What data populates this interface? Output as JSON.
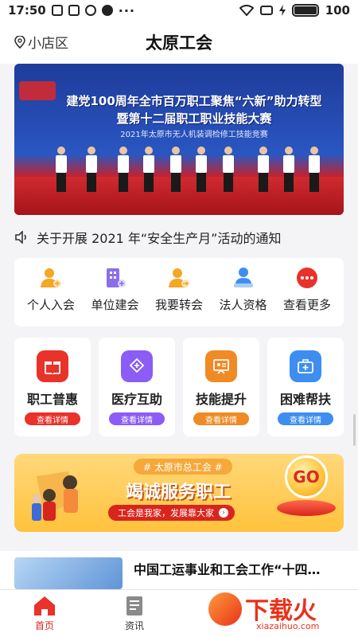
{
  "status_bar": {
    "time": "17:50",
    "battery": "100"
  },
  "header": {
    "location": "小店区",
    "title": "太原工会"
  },
  "banner": {
    "line1": "建党100周年全市百万职工聚焦“六新”助力转型",
    "line2": "暨第十二届职工职业技能大赛",
    "line3": "2021年太原市无人机装调检修工技能竞赛"
  },
  "notice": {
    "text": "关于开展 2021 年“安全生产月”活动的通知"
  },
  "quick_actions": [
    {
      "label": "个人入会",
      "icon": "person-join-icon",
      "color": "#f5a623"
    },
    {
      "label": "单位建会",
      "icon": "building-icon",
      "color": "#8b6fe8"
    },
    {
      "label": "我要转会",
      "icon": "person-transfer-icon",
      "color": "#f5a623"
    },
    {
      "label": "法人资格",
      "icon": "legal-person-icon",
      "color": "#3d8ef0"
    },
    {
      "label": "查看更多",
      "icon": "more-icon",
      "color": "#e8322a"
    }
  ],
  "services": [
    {
      "title": "职工普惠",
      "button": "查看详情",
      "icon": "gift-icon",
      "color": "#e8322a"
    },
    {
      "title": "医疗互助",
      "button": "查看详情",
      "icon": "medical-mutual-icon",
      "color": "#8b5cf6"
    },
    {
      "title": "技能提升",
      "button": "查看详情",
      "icon": "skill-board-icon",
      "color": "#f08a24"
    },
    {
      "title": "困难帮扶",
      "button": "查看详情",
      "icon": "first-aid-kit-icon",
      "color": "#3d8ef0"
    }
  ],
  "promo": {
    "tag": "# 太原市总工会 #",
    "slogan": "竭诚服务职工",
    "subtitle": "工会是我家，发展靠大家",
    "go": "GO"
  },
  "news": {
    "headline": "中国工运事业和工会工作“十四…"
  },
  "tabbar": {
    "home": "首页",
    "news": "资讯"
  },
  "watermark": {
    "text": "下载火",
    "url": "xiazaihuo.com"
  }
}
